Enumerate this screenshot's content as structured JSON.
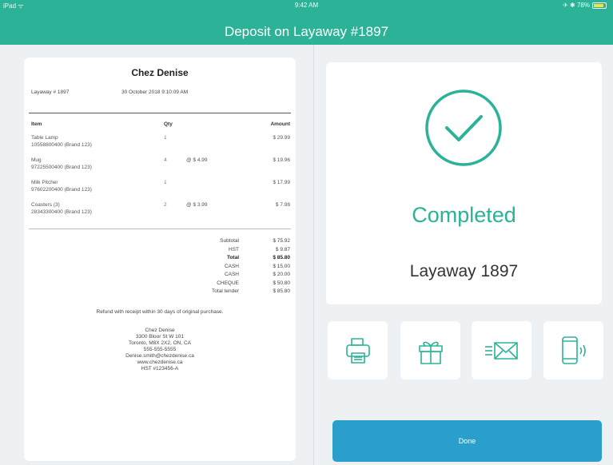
{
  "status_bar": {
    "left": "iPad ᯤ",
    "time": "9:42 AM",
    "right": "✈ ✱ 78%"
  },
  "nav": {
    "title": "Deposit on Layaway #1897"
  },
  "receipt": {
    "store_name": "Chez Denise",
    "layaway_label": "Layaway # 1897",
    "date": "30 October 2018 9:10:09 AM",
    "columns": {
      "item": "Item",
      "qty": "Qty",
      "amount": "Amount"
    },
    "items": [
      {
        "name": "Table Lamp",
        "sku": "10558800400 (Brand 123)",
        "qty": "1",
        "each": "",
        "amount": "$ 29.99"
      },
      {
        "name": "Mug",
        "sku": "97225500400 (Brand 123)",
        "qty": "4",
        "each": "@ $ 4.99",
        "amount": "$ 19.96"
      },
      {
        "name": "Milk Pitcher",
        "sku": "97602200400 (Brand 123)",
        "qty": "1",
        "each": "",
        "amount": "$ 17.99"
      },
      {
        "name": "Coasters (3)",
        "sku": "28343300400 (Brand 123)",
        "qty": "2",
        "each": "@ $ 3.99",
        "amount": "$ 7.98"
      }
    ],
    "totals": [
      {
        "label": "Subtotal",
        "value": "$ 75.92",
        "bold": false
      },
      {
        "label": "HST",
        "value": "$ 9.87",
        "bold": false
      },
      {
        "label": "Total",
        "value": "$ 85.80",
        "bold": true
      },
      {
        "label": "CASH",
        "value": "$ 15.00",
        "bold": false
      },
      {
        "label": "CASH",
        "value": "$ 20.00",
        "bold": false
      },
      {
        "label": "CHEQUE",
        "value": "$ 50.80",
        "bold": false
      },
      {
        "label": "Total tender",
        "value": "$ 85.80",
        "bold": false
      }
    ],
    "policy": "Refund with receipt within 30 days of original purchase.",
    "address_lines": [
      "Chez Denise",
      "3300 Bloor St W 101",
      "Toronto, M8X 2X2, ON, CA",
      "555-555-5555",
      "Denise.smith@chezdenise.ca",
      "www.chezdenise.ca",
      "HST #123456-A"
    ]
  },
  "status_card": {
    "state": "Completed",
    "layaway": "Layaway 1897"
  },
  "actions": [
    {
      "icon": "printer-icon",
      "name": "print-receipt-button"
    },
    {
      "icon": "gift-icon",
      "name": "gift-receipt-button"
    },
    {
      "icon": "email-icon",
      "name": "email-receipt-button"
    },
    {
      "icon": "text-message-icon",
      "name": "sms-receipt-button"
    }
  ],
  "done_label": "Done",
  "colors": {
    "accent": "#2bb297",
    "primary_button": "#2a9fcc",
    "background": "#eef1f4"
  }
}
